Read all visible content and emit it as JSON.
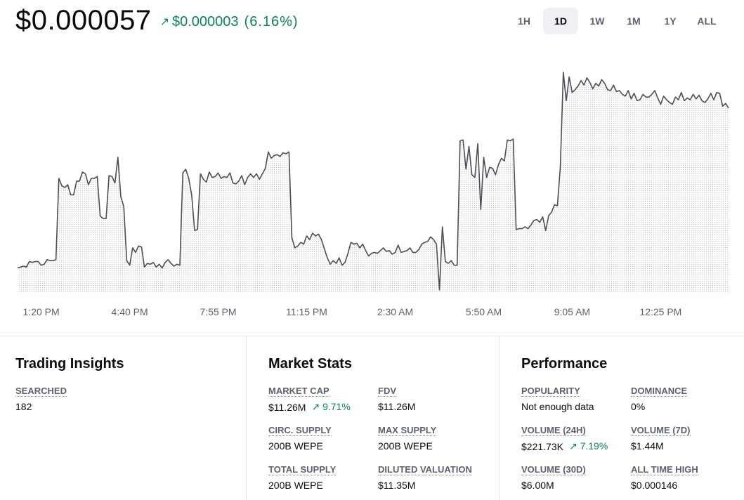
{
  "header": {
    "price": "$0.000057",
    "change_arrow": "↗",
    "change_amount": "$0.000003",
    "change_percent": "(6.16%)",
    "positive_color": "#098551"
  },
  "range_tabs": [
    {
      "label": "1H",
      "active": false
    },
    {
      "label": "1D",
      "active": true
    },
    {
      "label": "1W",
      "active": false
    },
    {
      "label": "1M",
      "active": false
    },
    {
      "label": "1Y",
      "active": false
    },
    {
      "label": "ALL",
      "active": false
    }
  ],
  "chart_data": {
    "type": "area",
    "x_tick_labels": [
      "1:20 PM",
      "4:40 PM",
      "7:55 PM",
      "11:15 PM",
      "2:30 AM",
      "5:50 AM",
      "9:05 AM",
      "12:25 PM"
    ],
    "x_tick_indices": [
      8,
      38,
      68,
      98,
      128,
      158,
      188,
      218
    ],
    "grid": false,
    "y_axis_visible": false,
    "ylim": [
      3.48e-05,
      6e-05
    ],
    "line_color": "#4a4e57",
    "values": [
      3.76e-05,
      3.77e-05,
      3.78e-05,
      3.77e-05,
      3.83e-05,
      3.82e-05,
      3.83e-05,
      3.83e-05,
      3.79e-05,
      3.8e-05,
      3.85e-05,
      3.84e-05,
      3.84e-05,
      3.85e-05,
      4.74e-05,
      4.66e-05,
      4.64e-05,
      4.67e-05,
      4.56e-05,
      4.56e-05,
      4.71e-05,
      4.71e-05,
      4.81e-05,
      4.79e-05,
      4.67e-05,
      4.74e-05,
      4.74e-05,
      4.76e-05,
      4.33e-05,
      4.3e-05,
      4.3e-05,
      4.77e-05,
      4.76e-05,
      4.69e-05,
      4.97e-05,
      4.54e-05,
      4.43e-05,
      3.84e-05,
      3.79e-05,
      3.98e-05,
      3.93e-05,
      4e-05,
      3.99e-05,
      3.77e-05,
      3.81e-05,
      3.8e-05,
      3.82e-05,
      3.77e-05,
      3.8e-05,
      3.76e-05,
      3.82e-05,
      3.85e-05,
      3.81e-05,
      3.78e-05,
      3.8e-05,
      3.79e-05,
      4.8e-05,
      4.84e-05,
      4.74e-05,
      4.56e-05,
      4.17e-05,
      4.18e-05,
      4.79e-05,
      4.73e-05,
      4.7e-05,
      4.81e-05,
      4.75e-05,
      4.76e-05,
      4.8e-05,
      4.74e-05,
      4.76e-05,
      4.75e-05,
      4.8e-05,
      4.69e-05,
      4.68e-05,
      4.71e-05,
      4.77e-05,
      4.67e-05,
      4.75e-05,
      4.79e-05,
      4.75e-05,
      4.79e-05,
      4.73e-05,
      4.79e-05,
      4.85e-05,
      5.03e-05,
      4.96e-05,
      4.99e-05,
      5e-05,
      4.98e-05,
      5.02e-05,
      5.01e-05,
      5.03e-05,
      4.09e-05,
      3.98e-05,
      4e-05,
      4.04e-05,
      4.02e-05,
      4.11e-05,
      4.07e-05,
      4.14e-05,
      4.11e-05,
      4.13e-05,
      4.07e-05,
      3.97e-05,
      3.87e-05,
      3.8e-05,
      3.84e-05,
      3.81e-05,
      3.87e-05,
      3.79e-05,
      3.82e-05,
      3.92e-05,
      4.04e-05,
      4.02e-05,
      4.03e-05,
      3.98e-05,
      4.02e-05,
      3.95e-05,
      3.89e-05,
      3.92e-05,
      3.93e-05,
      3.92e-05,
      3.95e-05,
      3.98e-05,
      3.94e-05,
      3.95e-05,
      3.91e-05,
      3.93e-05,
      4.01e-05,
      3.93e-05,
      3.94e-05,
      3.95e-05,
      3.98e-05,
      3.93e-05,
      3.93e-05,
      3.96e-05,
      4.02e-05,
      4.04e-05,
      4.05e-05,
      4.1e-05,
      4.07e-05,
      4.02e-05,
      3.52e-05,
      4.21e-05,
      3.83e-05,
      3.81e-05,
      3.84e-05,
      3.79e-05,
      3.79e-05,
      5.15e-05,
      5.16e-05,
      4.84e-05,
      5.09e-05,
      4.78e-05,
      4.75e-05,
      5.12e-05,
      4.4e-05,
      4.97e-05,
      4.75e-05,
      4.86e-05,
      4.85e-05,
      4.78e-05,
      4.89e-05,
      4.96e-05,
      4.93e-05,
      5.16e-05,
      5.15e-05,
      5.17e-05,
      4.18e-05,
      4.19e-05,
      4.19e-05,
      4.21e-05,
      4.19e-05,
      4.23e-05,
      4.28e-05,
      4.29e-05,
      4.26e-05,
      4.32e-05,
      4.17e-05,
      4.33e-05,
      4.37e-05,
      4.45e-05,
      4.44e-05,
      4.87e-05,
      5.9e-05,
      5.59e-05,
      5.85e-05,
      5.68e-05,
      5.71e-05,
      5.75e-05,
      5.81e-05,
      5.76e-05,
      5.84e-05,
      5.79e-05,
      5.72e-05,
      5.78e-05,
      5.75e-05,
      5.82e-05,
      5.78e-05,
      5.71e-05,
      5.7e-05,
      5.76e-05,
      5.69e-05,
      5.7e-05,
      5.66e-05,
      5.64e-05,
      5.7e-05,
      5.61e-05,
      5.67e-05,
      5.59e-05,
      5.6e-05,
      5.66e-05,
      5.63e-05,
      5.63e-05,
      5.66e-05,
      5.7e-05,
      5.62e-05,
      5.55e-05,
      5.64e-05,
      5.6e-05,
      5.57e-05,
      5.55e-05,
      5.63e-05,
      5.6e-05,
      5.68e-05,
      5.59e-05,
      5.62e-05,
      5.6e-05,
      5.66e-05,
      5.61e-05,
      5.65e-05,
      5.59e-05,
      5.57e-05,
      5.61e-05,
      5.67e-05,
      5.6e-05,
      5.68e-05,
      5.67e-05,
      5.53e-05,
      5.56e-05,
      5.51e-05
    ]
  },
  "panels": {
    "trading_insights": {
      "title": "Trading Insights",
      "stats": [
        {
          "label": "SEARCHED",
          "value": "182"
        }
      ]
    },
    "market_stats": {
      "title": "Market Stats",
      "stats": [
        {
          "label": "MARKET CAP",
          "value": "$11.26M",
          "change": "↗ 9.71%"
        },
        {
          "label": "FDV",
          "value": "$11.26M"
        },
        {
          "label": "CIRC. SUPPLY",
          "value": "200B WEPE"
        },
        {
          "label": "MAX SUPPLY",
          "value": "200B WEPE"
        },
        {
          "label": "TOTAL SUPPLY",
          "value": "200B WEPE"
        },
        {
          "label": "DILUTED VALUATION",
          "value": "$11.35M"
        }
      ]
    },
    "performance": {
      "title": "Performance",
      "stats": [
        {
          "label": "POPULARITY",
          "value": "Not enough data"
        },
        {
          "label": "DOMINANCE",
          "value": "0%"
        },
        {
          "label": "VOLUME (24H)",
          "value": "$221.73K",
          "change": "↗ 7.19%"
        },
        {
          "label": "VOLUME (7D)",
          "value": "$1.44M"
        },
        {
          "label": "VOLUME (30D)",
          "value": "$6.00M"
        },
        {
          "label": "ALL TIME HIGH",
          "value": "$0.000146"
        }
      ]
    }
  }
}
